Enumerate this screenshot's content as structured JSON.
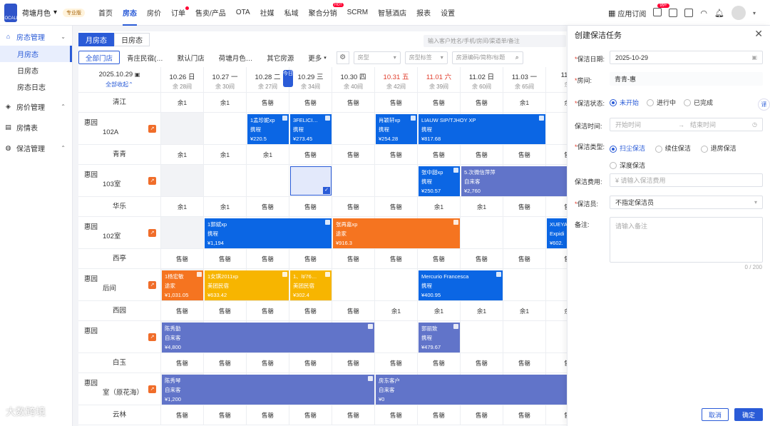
{
  "topbar": {
    "logo_text": "LOCALE",
    "store_name": "荷塘月色",
    "pro_badge": "专业版",
    "nav": [
      {
        "label": "首页",
        "active": false
      },
      {
        "label": "房态",
        "active": true
      },
      {
        "label": "房价",
        "active": false
      },
      {
        "label": "订单",
        "active": false,
        "dot": true
      },
      {
        "label": "售卖/产品",
        "active": false
      },
      {
        "label": "OTA",
        "active": false
      },
      {
        "label": "社媒",
        "active": false
      },
      {
        "label": "私域",
        "active": false
      },
      {
        "label": "聚合分销",
        "active": false,
        "hot": "HOT"
      },
      {
        "label": "SCRM",
        "active": false
      },
      {
        "label": "智慧酒店",
        "active": false
      },
      {
        "label": "报表",
        "active": false
      },
      {
        "label": "设置",
        "active": false
      }
    ],
    "app_subscribe": "应用订阅",
    "message_badge": "99+"
  },
  "sidebar": {
    "groups": [
      {
        "label": "房态管理",
        "icon": "home-icon",
        "expanded": true,
        "active": true,
        "items": [
          {
            "label": "月房态",
            "active": true
          },
          {
            "label": "日房态",
            "active": false
          },
          {
            "label": "房态日志",
            "active": false
          }
        ]
      },
      {
        "label": "房价管理",
        "icon": "price-tag-icon",
        "expanded": true,
        "items": []
      },
      {
        "label": "房情表",
        "icon": "document-icon",
        "expanded": false,
        "items": []
      },
      {
        "label": "保洁管理",
        "icon": "cleaning-icon",
        "expanded": true,
        "items": []
      }
    ]
  },
  "main": {
    "view_tabs": [
      {
        "label": "月房态",
        "active": true
      },
      {
        "label": "日房态",
        "active": false
      }
    ],
    "search_placeholder": "输入客户姓名/手机/房间/渠道单/备注",
    "store_tabs": [
      {
        "label": "全部门店",
        "active": true
      },
      {
        "label": "青庄民宿(…",
        "active": false
      },
      {
        "label": "默认门店",
        "active": false
      },
      {
        "label": "荷塘月色…",
        "active": false
      },
      {
        "label": "其它房源",
        "active": false
      },
      {
        "label": "更多",
        "active": false
      }
    ],
    "filter_roomtype": "房型",
    "filter_roomtag": "房型标签",
    "filter_search_placeholder": "房源编码/简称/标题",
    "date_header": {
      "date": "2025.10.29",
      "toggle": "全部收起"
    },
    "today_tag": "今日",
    "days": [
      {
        "date": "10.26 日",
        "remain": "余 28间",
        "red": false
      },
      {
        "date": "10.27 一",
        "remain": "余 30间",
        "red": false
      },
      {
        "date": "10.28 二",
        "remain": "余 27间",
        "red": false
      },
      {
        "date": "10.29 三",
        "remain": "余 34间",
        "red": false
      },
      {
        "date": "10.30 四",
        "remain": "余 40间",
        "red": false
      },
      {
        "date": "10.31 五",
        "remain": "余 42间",
        "red": true
      },
      {
        "date": "11.01 六",
        "remain": "余 39间",
        "red": true
      },
      {
        "date": "11.02 日",
        "remain": "余 60间",
        "red": false
      },
      {
        "date": "11.03 一",
        "remain": "余 65间",
        "red": false
      },
      {
        "date": "11.0",
        "remain": "余",
        "red": false
      }
    ],
    "rows": [
      {
        "type": "group",
        "name": "清江",
        "cells": [
          "余1",
          "余1",
          "售罄",
          "售罄",
          "售罄",
          "售罄",
          "售罄",
          "售罄",
          "余1",
          "余"
        ]
      },
      {
        "type": "room",
        "line1": "惠园",
        "line2": "102A"
      },
      {
        "type": "group",
        "name": "青青",
        "cells": [
          "余1",
          "余1",
          "余1",
          "售罄",
          "售罄",
          "售罄",
          "售罄",
          "售罄",
          "售罄",
          "售"
        ]
      },
      {
        "type": "room",
        "line1": "惠园",
        "line2": "103室"
      },
      {
        "type": "group",
        "name": "华乐",
        "cells": [
          "余1",
          "余1",
          "售罄",
          "售罄",
          "售罄",
          "售罄",
          "余1",
          "余1",
          "售罄",
          "售"
        ]
      },
      {
        "type": "room",
        "line1": "惠园",
        "line2": "102室"
      },
      {
        "type": "group",
        "name": "西亭",
        "cells": [
          "售罄",
          "售罄",
          "售罄",
          "售罄",
          "售罄",
          "售罄",
          "售罄",
          "售罄",
          "售罄",
          "售"
        ]
      },
      {
        "type": "room",
        "line1": "惠园",
        "line2": "后间"
      },
      {
        "type": "group",
        "name": "西园",
        "cells": [
          "售罄",
          "售罄",
          "售罄",
          "售罄",
          "售罄",
          "余1",
          "余1",
          "余1",
          "余1",
          "余"
        ]
      },
      {
        "type": "room",
        "line1": "惠园",
        "line2": ""
      },
      {
        "type": "group",
        "name": "白玉",
        "cells": [
          "售罄",
          "售罄",
          "售罄",
          "售罄",
          "售罄",
          "售罄",
          "售罄",
          "售罄",
          "售罄",
          "售"
        ]
      },
      {
        "type": "room",
        "line1": "惠园",
        "line2": "室（原花海）"
      },
      {
        "type": "group",
        "name": "云林",
        "cells": [
          "售罄",
          "售罄",
          "售罄",
          "售罄",
          "售罄",
          "售罄",
          "售罄",
          "售罄",
          "售罄",
          "售"
        ]
      }
    ],
    "bookings": [
      {
        "row": 1,
        "start": 2,
        "span": 1,
        "color": "#0b66e4",
        "name": "1孟珍妮xp",
        "channel": "携程",
        "price": "¥220.5"
      },
      {
        "row": 1,
        "start": 3,
        "span": 1,
        "color": "#0b66e4",
        "name": "3FELICI…",
        "channel": "携程",
        "price": "¥273.45"
      },
      {
        "row": 1,
        "start": 5,
        "span": 1,
        "color": "#0b66e4",
        "name": "肖颖轩xp",
        "channel": "携程",
        "price": "¥254.28"
      },
      {
        "row": 1,
        "start": 6,
        "span": 3,
        "color": "#0b66e4",
        "name": "LIAUW SIP/TJHOY XP",
        "channel": "携程",
        "price": "¥817.68"
      },
      {
        "row": 3,
        "start": 6,
        "span": 1,
        "color": "#0b66e4",
        "name": "张中甜xp",
        "channel": "携程",
        "price": "¥250.57"
      },
      {
        "row": 3,
        "start": 7,
        "span": 3,
        "color": "#6174c9",
        "name": "5.次微信萍萍",
        "channel": "自来客",
        "price": "¥2,760"
      },
      {
        "row": 5,
        "start": 1,
        "span": 3,
        "color": "#0b66e4",
        "name": "1郭斌xp",
        "channel": "携程",
        "price": "¥1,194"
      },
      {
        "row": 5,
        "start": 4,
        "span": 3,
        "color": "#f57420",
        "name": "张再嘉xp",
        "channel": "途家",
        "price": "¥916.3"
      },
      {
        "row": 5,
        "start": 9,
        "span": 1,
        "color": "#0b66e4",
        "name": "XUEYA",
        "channel": "Expidi",
        "price": "¥602."
      },
      {
        "row": 7,
        "start": 0,
        "span": 1,
        "color": "#f57420",
        "name": "1杨宏敏",
        "channel": "途家",
        "price": "¥1,031.05"
      },
      {
        "row": 7,
        "start": 1,
        "span": 2,
        "color": "#f7b500",
        "name": "1女琪2011xp",
        "channel": "美团民宿",
        "price": "¥633.42"
      },
      {
        "row": 7,
        "start": 3,
        "span": 1,
        "color": "#f7b500",
        "name": "1、lt/76…",
        "channel": "美团民宿",
        "price": "¥302.4"
      },
      {
        "row": 7,
        "start": 6,
        "span": 2,
        "color": "#0b66e4",
        "name": "Mercurio Francesca",
        "channel": "携程",
        "price": "¥400.95"
      },
      {
        "row": 9,
        "start": 0,
        "span": 5,
        "color": "#6174c9",
        "name": "陈秀勤",
        "channel": "自来客",
        "price": "¥4,800"
      },
      {
        "row": 9,
        "start": 6,
        "span": 1,
        "color": "#6174c9",
        "name": "郭丽致",
        "channel": "携程",
        "price": "¥479.67"
      },
      {
        "row": 11,
        "start": 0,
        "span": 5,
        "color": "#6174c9",
        "name": "陈秀琴",
        "channel": "自来客",
        "price": "¥1,200"
      },
      {
        "row": 11,
        "start": 5,
        "span": 5,
        "color": "#6174c9",
        "name": "房东客户",
        "channel": "自来客",
        "price": "¥0"
      }
    ],
    "selected_cell": {
      "row": 3,
      "col": 3
    }
  },
  "panel": {
    "title": "创建保洁任务",
    "date_label": "保洁日期:",
    "date_value": "2025-10-29",
    "room_label": "房间:",
    "room_value": "青青-惠",
    "status_label": "保洁状态:",
    "status_options": [
      {
        "label": "未开始",
        "selected": true
      },
      {
        "label": "进行中",
        "selected": false
      },
      {
        "label": "已完成",
        "selected": false
      }
    ],
    "time_label": "保洁时间:",
    "time_start_placeholder": "开始时间",
    "time_end_placeholder": "结束时间",
    "type_label": "保洁类型:",
    "type_options": [
      {
        "label": "扫尘保洁",
        "selected": true
      },
      {
        "label": "续住保洁",
        "selected": false
      },
      {
        "label": "退房保洁",
        "selected": false
      },
      {
        "label": "深度保洁",
        "selected": false
      }
    ],
    "fee_label": "保洁费用:",
    "fee_placeholder": "¥ 请输入保洁费用",
    "cleaner_label": "保洁员:",
    "cleaner_value": "不指定保洁员",
    "note_label": "备注:",
    "note_placeholder": "请输入备注",
    "note_counter": "0 / 200",
    "cancel_label": "取消",
    "confirm_label": "确定",
    "side_pill": "译"
  },
  "watermark": "大数跨境",
  "colors": {
    "accent": "#2a5bd7",
    "ctrip": "#0b66e4",
    "tujia": "#f57420",
    "meituan": "#f7b500",
    "direct": "#6174c9"
  }
}
